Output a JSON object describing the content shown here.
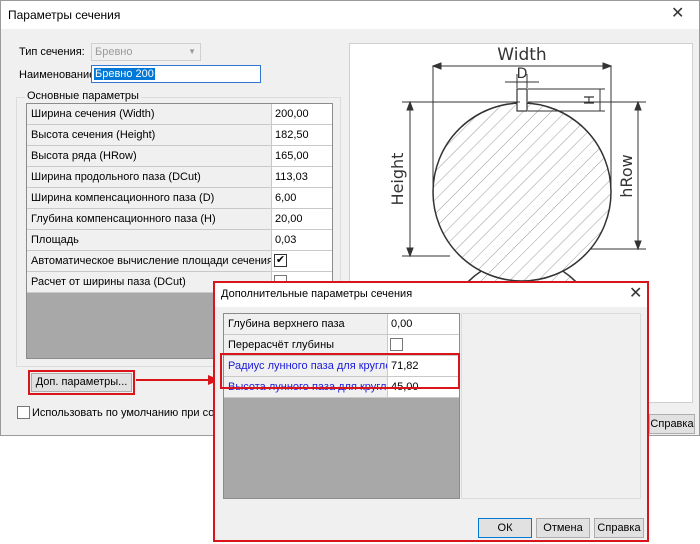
{
  "main_dialog": {
    "title": "Параметры сечения",
    "section_type_label": "Тип сечения:",
    "section_type_value": "Бревно",
    "name_label": "Наименование:",
    "name_value": "Бревно 200",
    "group_label": "Основные параметры",
    "params": [
      {
        "name": "Ширина сечения (Width)",
        "value": "200,00"
      },
      {
        "name": "Высота сечения (Height)",
        "value": "182,50"
      },
      {
        "name": "Высота ряда (HRow)",
        "value": "165,00"
      },
      {
        "name": "Ширина продольного паза (DCut)",
        "value": "113,03"
      },
      {
        "name": "Ширина компенсационного паза (D)",
        "value": "6,00"
      },
      {
        "name": "Глубина компенсационного паза (H)",
        "value": "20,00"
      },
      {
        "name": "Площадь",
        "value": "0,03"
      },
      {
        "name": "Автоматическое вычисление площади сечения",
        "checked": true
      },
      {
        "name": "Расчет от ширины паза (DCut)",
        "checked": false
      }
    ],
    "extra_params_button": "Доп. параметры...",
    "default_checkbox_label": "Использовать по умолчанию при создании нового",
    "help_button": "Справка"
  },
  "drawing_labels": {
    "width": "Width",
    "d": "D",
    "h": "H",
    "height": "Height",
    "hrow": "hRow"
  },
  "sub_dialog": {
    "title": "Дополнительные параметры сечения",
    "params": [
      {
        "name": "Глубина верхнего паза",
        "value": "0,00"
      },
      {
        "name": "Перерасчёт глубины",
        "checked": false
      },
      {
        "name": "Радиус лунного паза для круглого с...",
        "value": "71,82"
      },
      {
        "name": "Высота лунного паза для круглого ...",
        "value": "45,00"
      }
    ],
    "ok_button": "ОК",
    "cancel_button": "Отмена",
    "help_button": "Справка"
  },
  "colors": {
    "highlight_red": "#d9141b",
    "link_blue": "#1a1ad8",
    "selection_blue": "#0078d7"
  }
}
